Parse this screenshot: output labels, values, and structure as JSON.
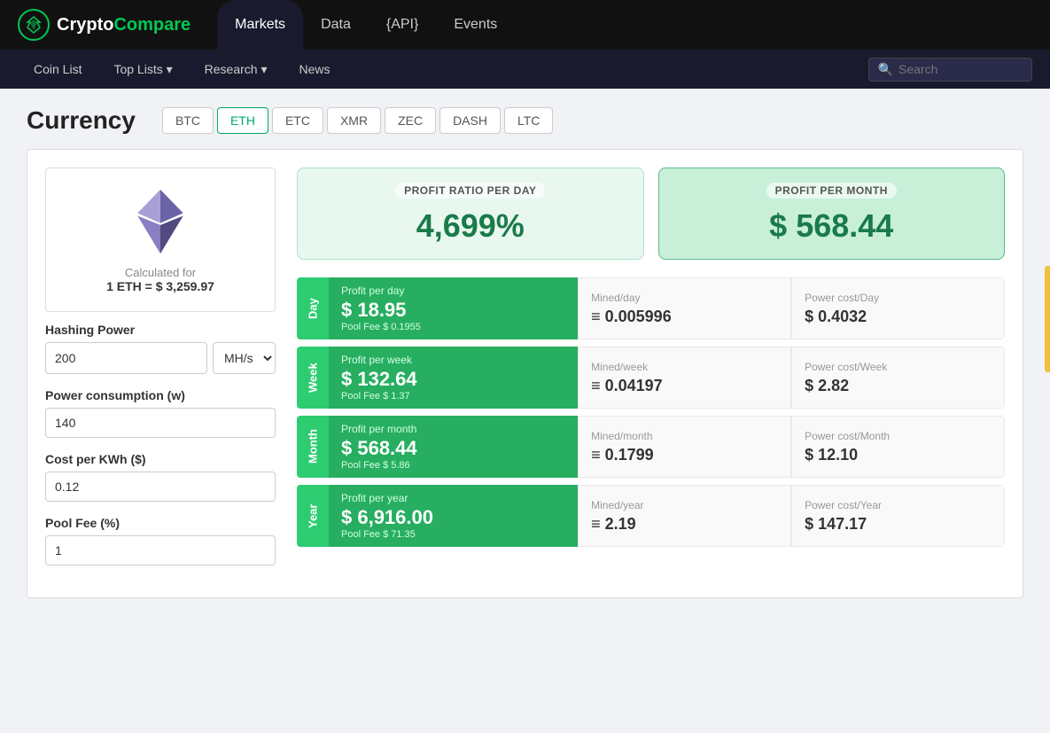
{
  "app": {
    "logo_text_crypto": "Crypto",
    "logo_text_compare": "Compare"
  },
  "top_nav": {
    "items": [
      {
        "label": "Markets",
        "active": true
      },
      {
        "label": "Data",
        "active": false
      },
      {
        "label": "{API}",
        "active": false
      },
      {
        "label": "Events",
        "active": false
      }
    ]
  },
  "secondary_nav": {
    "items": [
      {
        "label": "Coin List"
      },
      {
        "label": "Top Lists ▾"
      },
      {
        "label": "Research ▾"
      },
      {
        "label": "News"
      }
    ],
    "search_placeholder": "Search"
  },
  "currency": {
    "title": "Currency",
    "tabs": [
      {
        "label": "BTC",
        "active": false
      },
      {
        "label": "ETH",
        "active": true
      },
      {
        "label": "ETC",
        "active": false
      },
      {
        "label": "XMR",
        "active": false
      },
      {
        "label": "ZEC",
        "active": false
      },
      {
        "label": "DASH",
        "active": false
      },
      {
        "label": "LTC",
        "active": false
      }
    ]
  },
  "calc_info": {
    "label": "Calculated for",
    "value": "1 ETH = $ 3,259.97"
  },
  "form": {
    "hashing_power_label": "Hashing Power",
    "hashing_power_value": "200",
    "hashing_power_unit": "MH/s",
    "power_consumption_label": "Power consumption (w)",
    "power_consumption_value": "140",
    "cost_per_kwh_label": "Cost per KWh ($)",
    "cost_per_kwh_value": "0.12",
    "pool_fee_label": "Pool Fee (%)",
    "pool_fee_value": "1"
  },
  "summary": {
    "profit_ratio_label": "PROFIT RATIO PER DAY",
    "profit_ratio_value": "4,699%",
    "profit_month_label": "PROFIT PER MONTH",
    "profit_month_value": "$ 568.44"
  },
  "rows": [
    {
      "period_label": "Day",
      "profit_title": "Profit per day",
      "profit_amount": "$ 18.95",
      "pool_fee": "Pool Fee $ 0.1955",
      "mined_label": "Mined/day",
      "mined_value": "≡ 0.005996",
      "power_label": "Power cost/Day",
      "power_value": "$ 0.4032"
    },
    {
      "period_label": "Week",
      "profit_title": "Profit per week",
      "profit_amount": "$ 132.64",
      "pool_fee": "Pool Fee $ 1.37",
      "mined_label": "Mined/week",
      "mined_value": "≡ 0.04197",
      "power_label": "Power cost/Week",
      "power_value": "$ 2.82"
    },
    {
      "period_label": "Month",
      "profit_title": "Profit per month",
      "profit_amount": "$ 568.44",
      "pool_fee": "Pool Fee $ 5.86",
      "mined_label": "Mined/month",
      "mined_value": "≡ 0.1799",
      "power_label": "Power cost/Month",
      "power_value": "$ 12.10"
    },
    {
      "period_label": "Year",
      "profit_title": "Profit per year",
      "profit_amount": "$ 6,916.00",
      "pool_fee": "Pool Fee $ 71.35",
      "mined_label": "Mined/year",
      "mined_value": "≡ 2.19",
      "power_label": "Power cost/Year",
      "power_value": "$ 147.17"
    }
  ]
}
